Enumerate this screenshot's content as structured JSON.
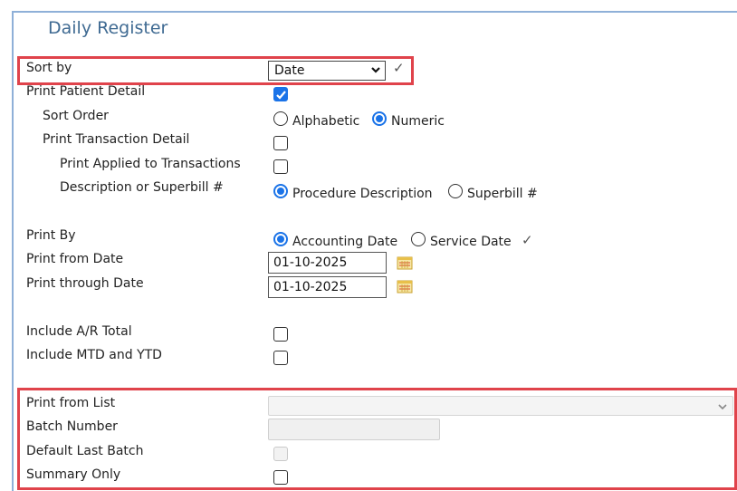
{
  "page": {
    "title": "Daily Register"
  },
  "sort_by": {
    "label": "Sort by",
    "value": "Date"
  },
  "print_patient_detail": {
    "label": "Print Patient Detail",
    "checked": true
  },
  "sort_order": {
    "label": "Sort Order",
    "options": [
      "Alphabetic",
      "Numeric"
    ],
    "selected": "Numeric"
  },
  "print_transaction_detail": {
    "label": "Print Transaction Detail",
    "checked": false
  },
  "print_applied": {
    "label": "Print Applied to Transactions",
    "checked": false
  },
  "description": {
    "label": "Description or Superbill #",
    "options": [
      "Procedure Description",
      "Superbill #"
    ],
    "selected": "Procedure Description"
  },
  "print_by": {
    "label": "Print By",
    "options": [
      "Accounting Date",
      "Service Date"
    ],
    "selected": "Accounting Date"
  },
  "print_from_date": {
    "label": "Print from Date",
    "value": "01-10-2025"
  },
  "print_through_date": {
    "label": "Print through Date",
    "value": "01-10-2025"
  },
  "include_ar_total": {
    "label": "Include A/R Total",
    "checked": false
  },
  "include_mtd_ytd": {
    "label": "Include MTD and YTD",
    "checked": false
  },
  "print_from_list": {
    "label": "Print from List",
    "value": ""
  },
  "batch_number": {
    "label": "Batch Number",
    "value": ""
  },
  "default_last_batch": {
    "label": "Default Last Batch",
    "checked": false,
    "disabled": true
  },
  "summary_only": {
    "label": "Summary Only",
    "checked": false
  },
  "colors": {
    "accent": "#1a73e8",
    "highlight_border": "#e0434b",
    "title": "#3f6a92",
    "frame": "#8fb0d8"
  },
  "icons": {
    "validated": "check-icon",
    "calendar": "calendar-icon",
    "dropdown": "chevron-down-icon"
  }
}
